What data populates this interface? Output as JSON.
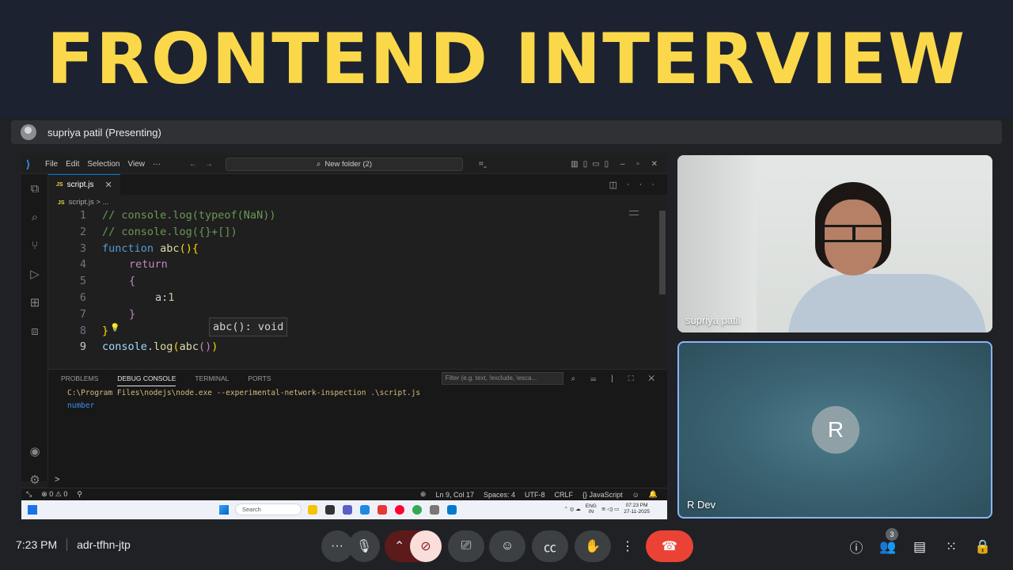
{
  "banner": {
    "title": "FRONTEND INTERVIEW"
  },
  "presenter": {
    "label": "supriya patil (Presenting)"
  },
  "vscode": {
    "menu": [
      "File",
      "Edit",
      "Selection",
      "View",
      "···"
    ],
    "command_center": "New folder (2)",
    "tab": {
      "badge": "JS",
      "name": "script.js"
    },
    "breadcrumb": "script.js > ...",
    "code_lines": [
      {
        "n": "1",
        "text": "// console.log(typeof(NaN))"
      },
      {
        "n": "2",
        "text": "// console.log({}+[])"
      },
      {
        "n": "3",
        "kw": "function",
        "fn": "abc",
        "rest": "(){"
      },
      {
        "n": "4",
        "text": "return"
      },
      {
        "n": "5",
        "text": "{"
      },
      {
        "n": "6",
        "var": "a",
        "colon": ":",
        "num": "1"
      },
      {
        "n": "7",
        "text": "}"
      },
      {
        "n": "8",
        "text": "}"
      },
      {
        "n": "9",
        "obj": "console",
        "dot": ".",
        "fn": "log",
        "open": "(",
        "call": "abc",
        "parens": "()",
        "close": ")"
      }
    ],
    "hover_tip": "abc(): void",
    "panel": {
      "tabs": [
        "PROBLEMS",
        "DEBUG CONSOLE",
        "TERMINAL",
        "PORTS"
      ],
      "active_tab": "DEBUG CONSOLE",
      "filter_placeholder": "Filter (e.g. text, !exclude, \\esca...",
      "console_cmd": "C:\\Program Files\\nodejs\\node.exe --experimental-network-inspection .\\script.js",
      "console_output": "number",
      "prompt": ">"
    },
    "status": {
      "errors": "⊗ 0 ⚠ 0",
      "position": "Ln 9, Col 17",
      "spaces": "Spaces: 4",
      "encoding": "UTF-8",
      "eol": "CRLF",
      "language": "{} JavaScript"
    },
    "taskbar": {
      "search": "Search",
      "lang_top": "ENG",
      "lang_bottom": "IN",
      "time": "07:23 PM",
      "date": "27-11-2025"
    }
  },
  "tiles": {
    "video_name": "supriya patil",
    "rdev_initial": "R",
    "rdev_name": "R Dev"
  },
  "meeting": {
    "time": "7:23 PM",
    "code": "adr-tfhn-jtp",
    "people_count": "3"
  },
  "colors": {
    "banner_text": "#fbd84a",
    "end_call": "#ea4335",
    "camera_off": "#f9dedc",
    "vscode_accent": "#0078d4"
  }
}
